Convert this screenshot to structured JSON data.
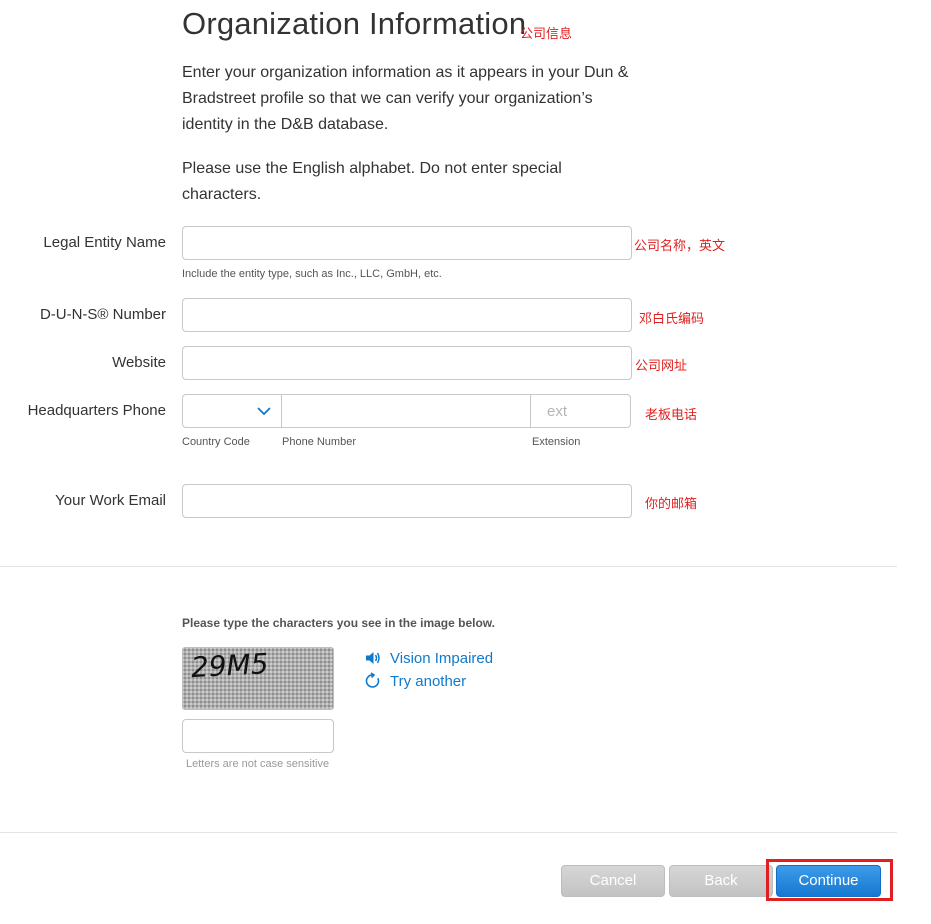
{
  "page": {
    "title": "Organization Information",
    "title_note": "公司信息",
    "intro_1": "Enter your organization information as it appears in your Dun & Bradstreet profile so that we can verify your organization’s identity in the D&B database.",
    "intro_2": "Please use the English alphabet. Do not enter special characters."
  },
  "form": {
    "legal_entity": {
      "label": "Legal Entity Name",
      "value": "",
      "helper": "Include the entity type, such as Inc., LLC, GmbH, etc.",
      "note": "公司名称，英文"
    },
    "duns": {
      "label": "D-U-N-S® Number",
      "value": "",
      "note": "邓白氏编码"
    },
    "website": {
      "label": "Website",
      "value": "",
      "note": "公司网址"
    },
    "phone": {
      "label": "Headquarters Phone",
      "country_code_label": "Country Code",
      "country_code_value": "",
      "number_label": "Phone Number",
      "number_value": "",
      "extension_label": "Extension",
      "extension_placeholder": "ext",
      "note": "老板电话"
    },
    "email": {
      "label": "Your Work Email",
      "value": "",
      "note": "你的邮箱"
    }
  },
  "captcha": {
    "prompt": "Please type the characters you see in the image below.",
    "image_text": "29M5",
    "vision_impaired": "Vision Impaired",
    "try_another": "Try another",
    "value": "",
    "note": "Letters are not case sensitive"
  },
  "buttons": {
    "cancel": "Cancel",
    "back": "Back",
    "continue": "Continue"
  },
  "colors": {
    "accent": "#1778d1",
    "link": "#0f7acc",
    "annotation": "#e02020",
    "button_gray": "#c8c8c8"
  }
}
